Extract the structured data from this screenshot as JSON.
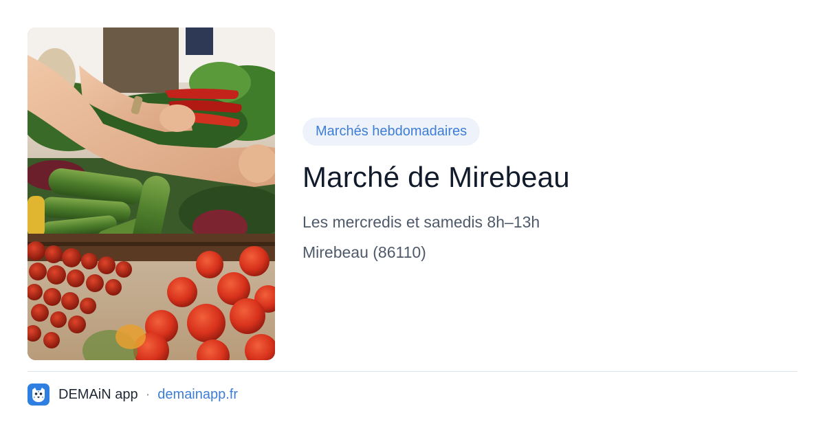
{
  "card": {
    "image_icon": "market-produce-photo",
    "category": "Marchés hebdomadaires",
    "title": "Marché de Mirebeau",
    "schedule": "Les mercredis et samedis 8h–13h",
    "location": "Mirebeau (86110)"
  },
  "footer": {
    "app_icon": "demain-leopard-icon",
    "app_name": "DEMAiN app",
    "separator": "·",
    "link_text": "demainapp.fr"
  },
  "colors": {
    "accent": "#3d7dd6",
    "badge_bg": "#eef3fb",
    "title": "#111b2b",
    "muted": "#4e5a6a",
    "divider": "#dbe3ea"
  }
}
